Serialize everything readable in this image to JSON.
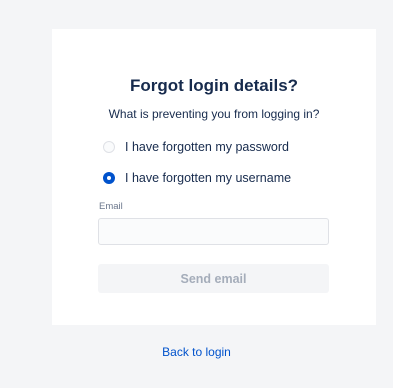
{
  "card": {
    "title": "Forgot login details?",
    "subtitle": "What is preventing you from logging in?",
    "options": [
      {
        "label": "I have forgotten my password",
        "checked": false
      },
      {
        "label": "I have forgotten my username",
        "checked": true
      }
    ],
    "email": {
      "label": "Email",
      "value": ""
    },
    "send_label": "Send email"
  },
  "footer": {
    "back_label": "Back to login"
  },
  "colors": {
    "accent": "#0052cc",
    "background": "#f4f5f7",
    "card": "#ffffff",
    "text": "#172b4d",
    "disabled_text": "#a5adba"
  }
}
